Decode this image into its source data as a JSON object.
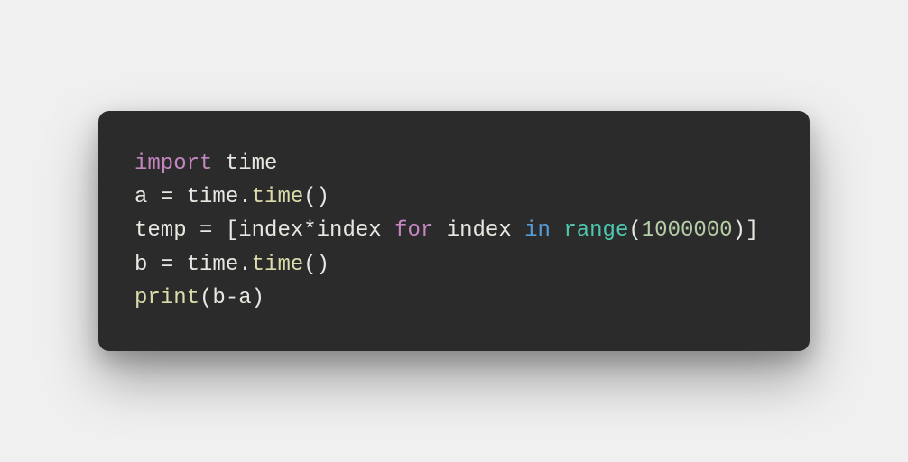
{
  "code": {
    "line1": {
      "import_kw": "import",
      "sp1": " ",
      "module": "time"
    },
    "line2": {
      "var": "a ",
      "eq": "=",
      "sp": " ",
      "obj": "time.",
      "fn": "time",
      "paren": "()"
    },
    "line3": {
      "var": "temp ",
      "eq": "=",
      "sp1": " ",
      "lbracket": "[",
      "expr": "index*index",
      "sp2": " ",
      "for_kw": "for",
      "sp3": " ",
      "iter": "index",
      "sp4": " ",
      "in_kw": "in",
      "sp5": " ",
      "range_fn": "range",
      "lparen": "(",
      "num": "1000000",
      "rparen": ")",
      "rbracket": "]"
    },
    "line4": {
      "var": "b ",
      "eq": "=",
      "sp": " ",
      "obj": "time.",
      "fn": "time",
      "paren": "()"
    },
    "line5": {
      "fn": "print",
      "lparen": "(",
      "expr": "b-a",
      "rparen": ")"
    }
  }
}
